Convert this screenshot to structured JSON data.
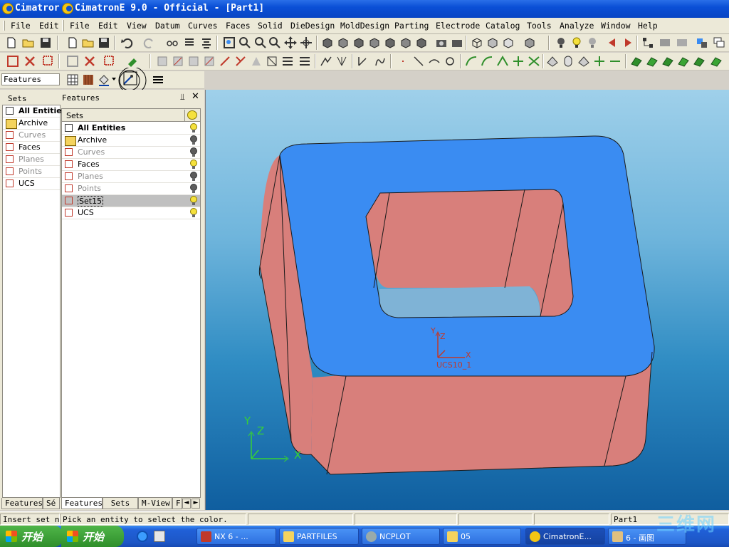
{
  "title_bar": {
    "app_short": "Cimatror",
    "title": "CimatronE 9.0 - Official - [Part1]"
  },
  "menu_left": [
    "File",
    "Edit"
  ],
  "menu": [
    "File",
    "Edit",
    "View",
    "Datum",
    "Curves",
    "Faces",
    "Solid",
    "DieDesign",
    "MoldDesign",
    "Parting",
    "Electrode",
    "Catalog",
    "Tools",
    "Analyze",
    "Window",
    "Help"
  ],
  "toolbar": {
    "features_label": "Features"
  },
  "sets_panel": {
    "title": "Sets",
    "items": [
      "All Entitie:",
      "Archive",
      "Curves",
      "Faces",
      "Planes",
      "Points",
      "UCS"
    ]
  },
  "features_panel": {
    "title": "Features",
    "header": "Sets",
    "items": [
      {
        "label": "All Entities",
        "bulb": "on"
      },
      {
        "label": "Archive",
        "bulb": "off"
      },
      {
        "label": "Curves",
        "bulb": "off"
      },
      {
        "label": "Faces",
        "bulb": "on"
      },
      {
        "label": "Planes",
        "bulb": "off"
      },
      {
        "label": "Points",
        "bulb": "off"
      },
      {
        "label": "Set15",
        "bulb": "on"
      },
      {
        "label": "UCS",
        "bulb": "on"
      }
    ]
  },
  "bottom_tabs": [
    "Features",
    "Sé",
    "Features",
    "Sets",
    "M-View",
    "F"
  ],
  "viewport": {
    "ucs_name": "UCS10_1",
    "axis_x": "X",
    "axis_y": "Y",
    "axis_z": "Z",
    "part_top_color": "#3a8cf2",
    "part_side_color": "#d87f7b"
  },
  "status_bar": {
    "left": "Insert set nam",
    "prompt": "Pick an entity to select the color.",
    "part": "Part1"
  },
  "taskbar": {
    "start": "开始",
    "start2": "开始",
    "tasks": [
      "NX 6 - ...",
      "PARTFILES",
      "NCPLOT",
      "05",
      "CimatronE...",
      "6 - 画图"
    ]
  },
  "watermark": "三维网"
}
